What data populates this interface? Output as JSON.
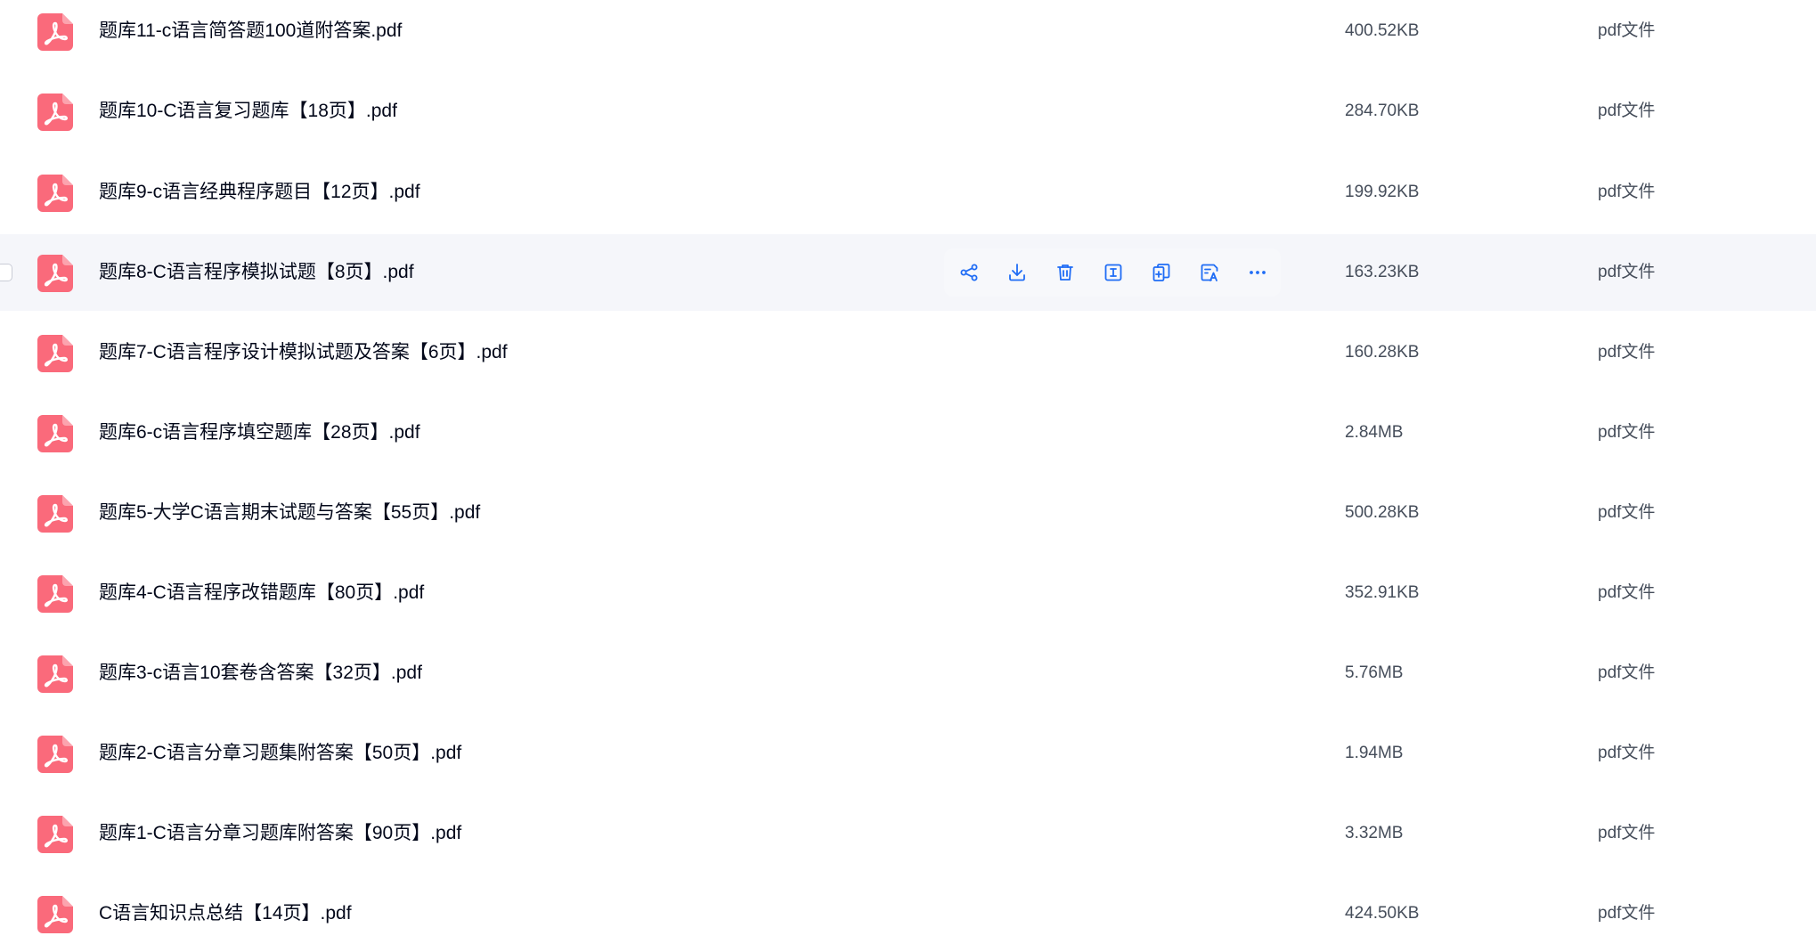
{
  "colors": {
    "accent": "#1f6cf5",
    "pdf_icon": "#fa6a7b",
    "hover_row": "#f5f6fa"
  },
  "files": [
    {
      "name": "题库11-c语言简答题100道附答案.pdf",
      "size": "400.52KB",
      "type": "pdf文件"
    },
    {
      "name": "题库10-C语言复习题库【18页】.pdf",
      "size": "284.70KB",
      "type": "pdf文件"
    },
    {
      "name": "题库9-c语言经典程序题目【12页】.pdf",
      "size": "199.92KB",
      "type": "pdf文件"
    },
    {
      "name": "题库8-C语言程序模拟试题【8页】.pdf",
      "size": "163.23KB",
      "type": "pdf文件"
    },
    {
      "name": "题库7-C语言程序设计模拟试题及答案【6页】.pdf",
      "size": "160.28KB",
      "type": "pdf文件"
    },
    {
      "name": "题库6-c语言程序填空题库【28页】.pdf",
      "size": "2.84MB",
      "type": "pdf文件"
    },
    {
      "name": "题库5-大学C语言期末试题与答案【55页】.pdf",
      "size": "500.28KB",
      "type": "pdf文件"
    },
    {
      "name": "题库4-C语言程序改错题库【80页】.pdf",
      "size": "352.91KB",
      "type": "pdf文件"
    },
    {
      "name": "题库3-c语言10套卷含答案【32页】.pdf",
      "size": "5.76MB",
      "type": "pdf文件"
    },
    {
      "name": "题库2-C语言分章习题集附答案【50页】.pdf",
      "size": "1.94MB",
      "type": "pdf文件"
    },
    {
      "name": "题库1-C语言分章习题库附答案【90页】.pdf",
      "size": "3.32MB",
      "type": "pdf文件"
    },
    {
      "name": "C语言知识点总结【14页】.pdf",
      "size": "424.50KB",
      "type": "pdf文件"
    }
  ],
  "hover_actions": [
    "share-icon",
    "download-icon",
    "delete-icon",
    "rename-icon",
    "copy-icon",
    "translate-icon",
    "more-icon"
  ]
}
